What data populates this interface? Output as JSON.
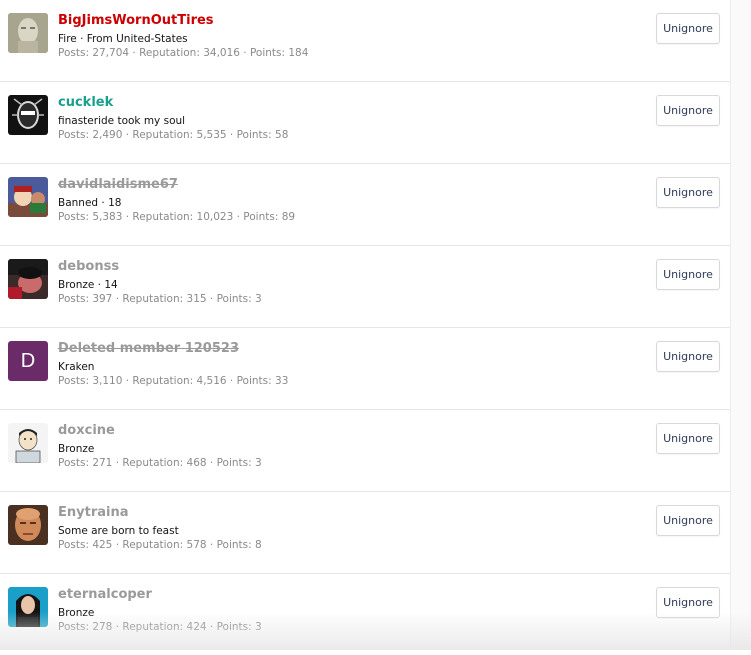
{
  "unignore_label": "Unignore",
  "members": [
    {
      "name": "BigJimsWornOutTires",
      "name_color": "#cc0000",
      "strike": false,
      "title": "Fire · From United-States",
      "stats": "Posts: 27,704 · Reputation: 34,016 · Points: 184",
      "avatar": "statue"
    },
    {
      "name": "cucklek",
      "name_color": "#1a9f8c",
      "strike": false,
      "title": "finasteride took my soul",
      "stats": "Posts: 2,490 · Reputation: 5,535 · Points: 58",
      "avatar": "dark-face"
    },
    {
      "name": "davidlaidisme67",
      "name_color": "#9a9a9a",
      "strike": true,
      "title": "Banned · 18",
      "stats": "Posts: 5,383 · Reputation: 10,023 · Points: 89",
      "avatar": "cartoon"
    },
    {
      "name": "debonss",
      "name_color": "#9a9a9a",
      "strike": false,
      "title": "Bronze · 14",
      "stats": "Posts: 397 · Reputation: 315 · Points: 3",
      "avatar": "photo"
    },
    {
      "name": "Deleted member 120523",
      "name_color": "#9a9a9a",
      "strike": true,
      "title": "Kraken",
      "stats": "Posts: 3,110 · Reputation: 4,516 · Points: 33",
      "avatar": "letter",
      "avatar_letter": "D",
      "avatar_color": "#6b2b68"
    },
    {
      "name": "doxcine",
      "name_color": "#9a9a9a",
      "strike": false,
      "title": "Bronze",
      "stats": "Posts: 271 · Reputation: 468 · Points: 3",
      "avatar": "drawing"
    },
    {
      "name": "Enytraina",
      "name_color": "#9a9a9a",
      "strike": false,
      "title": "Some are born to feast",
      "stats": "Posts: 425 · Reputation: 578 · Points: 8",
      "avatar": "bald-face"
    },
    {
      "name": "eternalcoper",
      "name_color": "#9a9a9a",
      "strike": false,
      "title": "Bronze",
      "stats": "Posts: 278 · Reputation: 424 · Points: 3",
      "avatar": "woman"
    }
  ]
}
